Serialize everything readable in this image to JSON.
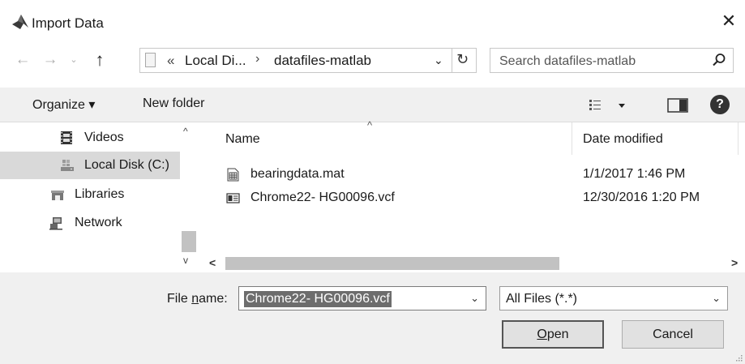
{
  "window": {
    "title": "Import Data",
    "close_glyph": "✕",
    "icon": "matlab-icon"
  },
  "navbar": {
    "back_glyph": "←",
    "forward_glyph": "→",
    "recent_glyph": "⌄",
    "up_glyph": "↑",
    "address": {
      "chevrons": "«",
      "segments": [
        "Local Di...",
        "datafiles-matlab"
      ],
      "separator": "›",
      "dropdown_glyph": "⌄",
      "refresh_glyph": "↻"
    },
    "search": {
      "placeholder": "Search datafiles-matlab"
    }
  },
  "toolbar": {
    "organize_label": "Organize ▾",
    "new_folder_label": "New folder",
    "help_glyph": "?"
  },
  "nav_pane": {
    "items": [
      {
        "label": "Videos",
        "icon": "video-icon",
        "selected": false
      },
      {
        "label": "Local Disk (C:)",
        "icon": "drive-icon",
        "selected": true
      },
      {
        "label": "Libraries",
        "icon": "library-icon",
        "selected": false
      },
      {
        "label": "Network",
        "icon": "network-icon",
        "selected": false
      }
    ],
    "scroll_up_glyph": "^",
    "scroll_down_glyph": "v"
  },
  "file_list": {
    "columns": [
      "Name",
      "Date modified"
    ],
    "sort_glyph": "^",
    "rows": [
      {
        "name": "bearingdata.mat",
        "date": "1/1/2017 1:46 PM",
        "icon": "mat-file-icon"
      },
      {
        "name": "Chrome22- HG00096.vcf",
        "date": "12/30/2016 1:20 PM",
        "icon": "contact-card-icon"
      }
    ],
    "hscroll_left_glyph": "<",
    "hscroll_right_glyph": ">"
  },
  "bottom": {
    "file_name_label_pre": "File ",
    "file_name_label_key": "n",
    "file_name_label_post": "ame:",
    "file_name_value": "Chrome22- HG00096.vcf",
    "file_type_value": "All Files (*.*)",
    "dropdown_glyph": "⌄",
    "open_label_key": "O",
    "open_label_rest": "pen",
    "cancel_label": "Cancel"
  }
}
